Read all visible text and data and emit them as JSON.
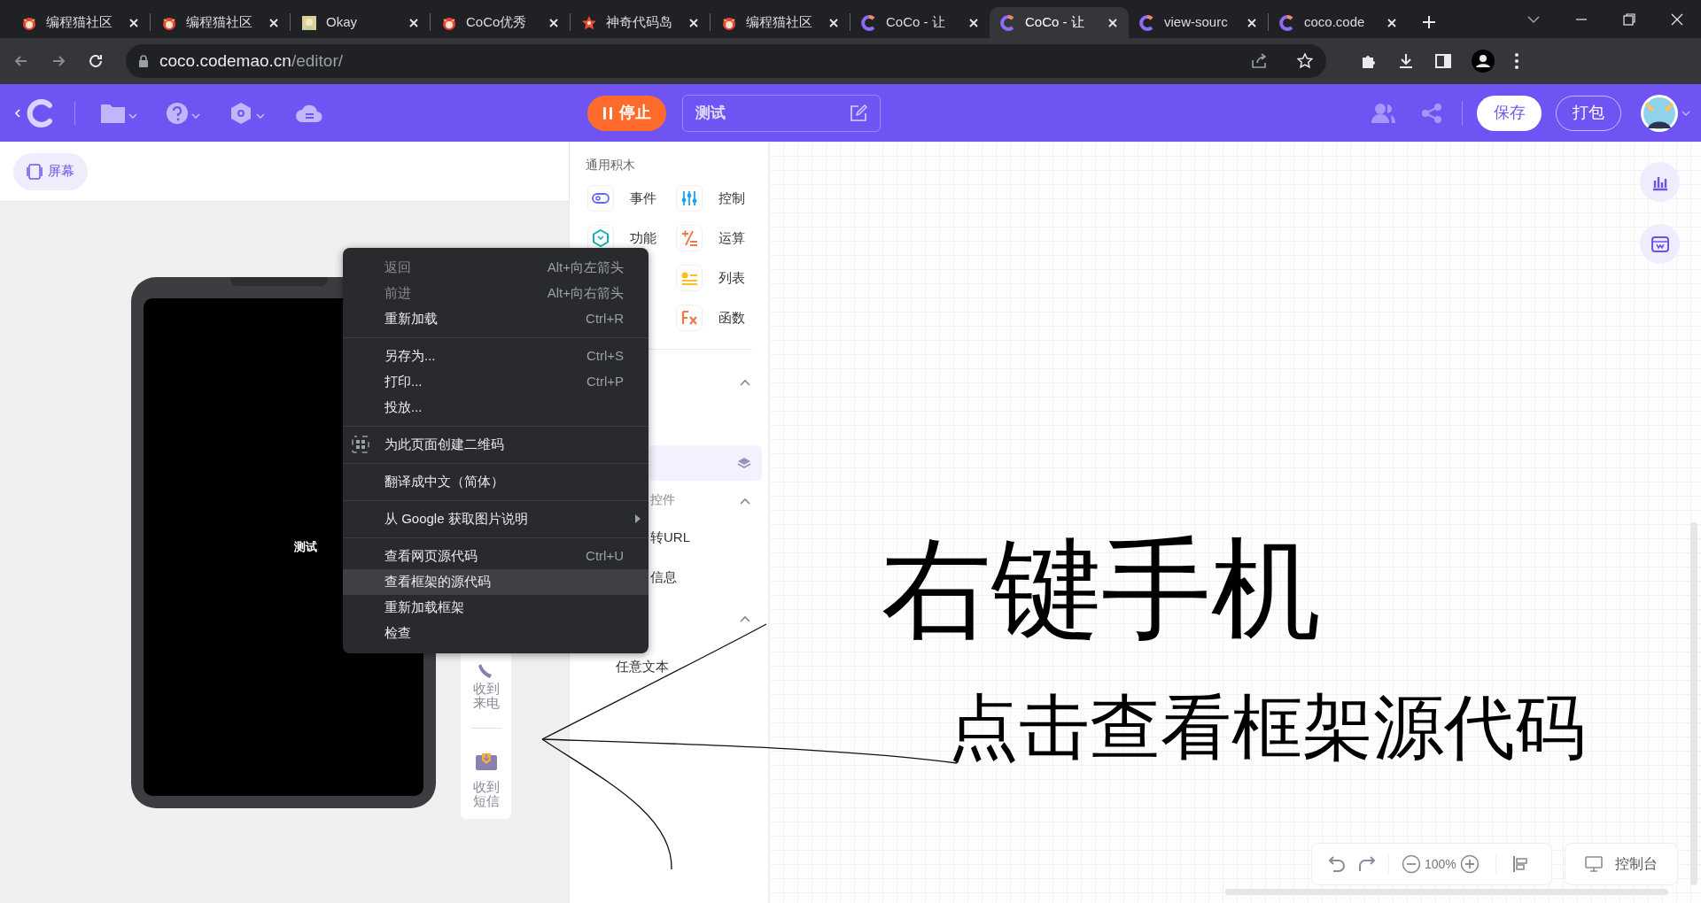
{
  "browser": {
    "tabs": [
      {
        "title": "编程猫社区",
        "kind": "cat",
        "selected": false
      },
      {
        "title": "编程猫社区",
        "kind": "cat",
        "selected": false
      },
      {
        "title": "Okay",
        "kind": "thumb",
        "selected": false
      },
      {
        "title": "CoCo优秀",
        "kind": "cat",
        "selected": false
      },
      {
        "title": "神奇代码岛",
        "kind": "star",
        "selected": false
      },
      {
        "title": "编程猫社区",
        "kind": "cat",
        "selected": false
      },
      {
        "title": "CoCo - 让",
        "kind": "coco",
        "selected": false
      },
      {
        "title": "CoCo - 让",
        "kind": "coco",
        "selected": true
      },
      {
        "title": "view-sourc",
        "kind": "coco",
        "selected": false
      },
      {
        "title": "coco.code",
        "kind": "coco",
        "selected": false
      }
    ],
    "url_host": "coco.codemao.cn",
    "url_path": "/editor/"
  },
  "toolbar": {
    "stop_button": "停止",
    "project_name": "测试",
    "save_button": "保存",
    "package_button": "打包"
  },
  "stage": {
    "screen_button": "屏幕",
    "phone_text": "测试",
    "side_items": [
      "收到来电",
      "收到短信"
    ]
  },
  "blocks": {
    "header": "通用积木",
    "items": [
      {
        "label": "事件",
        "kind": "event"
      },
      {
        "label": "功能",
        "kind": "function"
      },
      {
        "label": "控制",
        "kind": "control"
      },
      {
        "label": "运算",
        "kind": "operator"
      },
      {
        "label": "列表",
        "kind": "list"
      },
      {
        "label": "函数",
        "kind": "fx"
      }
    ],
    "rows": [
      "控件",
      "转URL",
      "信息",
      "任意文本"
    ]
  },
  "context_menu": {
    "groups": [
      [
        {
          "label": "返回",
          "shortcut": "Alt+向左箭头",
          "kind": "plain",
          "disabled": true,
          "selected": false,
          "submenu": false
        },
        {
          "label": "前进",
          "shortcut": "Alt+向右箭头",
          "kind": "plain",
          "disabled": true,
          "selected": false,
          "submenu": false
        },
        {
          "label": "重新加载",
          "shortcut": "Ctrl+R",
          "kind": "plain",
          "disabled": false,
          "selected": false,
          "submenu": false
        }
      ],
      [
        {
          "label": "另存为...",
          "shortcut": "Ctrl+S",
          "kind": "plain",
          "disabled": false,
          "selected": false,
          "submenu": false
        },
        {
          "label": "打印...",
          "shortcut": "Ctrl+P",
          "kind": "plain",
          "disabled": false,
          "selected": false,
          "submenu": false
        },
        {
          "label": "投放...",
          "kind": "plain",
          "disabled": false,
          "selected": false,
          "submenu": false
        }
      ],
      [
        {
          "label": "为此页面创建二维码",
          "kind": "qr",
          "disabled": false,
          "selected": false,
          "submenu": false
        }
      ],
      [
        {
          "label": "翻译成中文（简体）",
          "kind": "plain",
          "disabled": false,
          "selected": false,
          "submenu": false
        }
      ],
      [
        {
          "label": "从 Google 获取图片说明",
          "kind": "plain",
          "disabled": false,
          "selected": false,
          "submenu": true
        }
      ],
      [
        {
          "label": "查看网页源代码",
          "shortcut": "Ctrl+U",
          "kind": "plain",
          "disabled": false,
          "selected": false,
          "submenu": false
        },
        {
          "label": "查看框架的源代码",
          "kind": "plain",
          "disabled": false,
          "selected": true,
          "submenu": false
        },
        {
          "label": "重新加载框架",
          "kind": "plain",
          "disabled": false,
          "selected": false,
          "submenu": false
        },
        {
          "label": "检查",
          "kind": "plain",
          "disabled": false,
          "selected": false,
          "submenu": false
        }
      ]
    ]
  },
  "annotation": {
    "title": "右键手机",
    "subtitle": "点击查看框架源代码"
  },
  "canvas_bar": {
    "zoom": "100%",
    "console_button": "控制台"
  }
}
